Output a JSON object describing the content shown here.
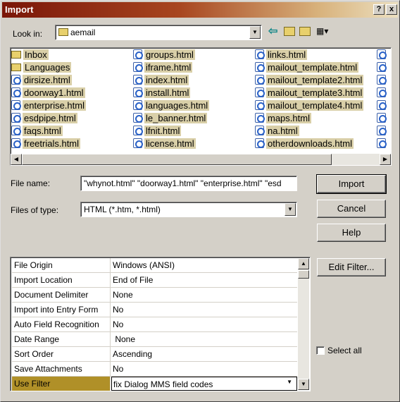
{
  "window": {
    "title": "Import"
  },
  "titlebar": {
    "help_btn": "?",
    "close_btn": "x"
  },
  "look_in": {
    "label": "Look in:",
    "value": "aemail"
  },
  "file_list": {
    "columns": [
      [
        {
          "name": "Inbox",
          "icon": "folder-icon"
        },
        {
          "name": "Languages",
          "icon": "folder-icon"
        },
        {
          "name": "dirsize.html",
          "icon": "html-file-icon"
        },
        {
          "name": "doorway1.html",
          "icon": "html-file-icon"
        },
        {
          "name": "enterprise.html",
          "icon": "html-file-icon"
        },
        {
          "name": "esdpipe.html",
          "icon": "html-file-icon"
        },
        {
          "name": "faqs.html",
          "icon": "html-file-icon"
        },
        {
          "name": "freetrials.html",
          "icon": "html-file-icon"
        }
      ],
      [
        {
          "name": "groups.html",
          "icon": "html-file-icon"
        },
        {
          "name": "iframe.html",
          "icon": "html-file-icon"
        },
        {
          "name": "index.html",
          "icon": "html-file-icon"
        },
        {
          "name": "install.html",
          "icon": "html-file-icon"
        },
        {
          "name": "languages.html",
          "icon": "html-file-icon"
        },
        {
          "name": "le_banner.html",
          "icon": "html-file-icon"
        },
        {
          "name": "lfnit.html",
          "icon": "html-file-icon"
        },
        {
          "name": "license.html",
          "icon": "html-file-icon"
        }
      ],
      [
        {
          "name": "links.html",
          "icon": "html-file-icon"
        },
        {
          "name": "mailout_template.html",
          "icon": "html-file-icon"
        },
        {
          "name": "mailout_template2.html",
          "icon": "html-file-icon"
        },
        {
          "name": "mailout_template3.html",
          "icon": "html-file-icon"
        },
        {
          "name": "mailout_template4.html",
          "icon": "html-file-icon"
        },
        {
          "name": "maps.html",
          "icon": "html-file-icon"
        },
        {
          "name": "na.html",
          "icon": "html-file-icon"
        },
        {
          "name": "otherdownloads.html",
          "icon": "html-file-icon"
        }
      ]
    ]
  },
  "file_name": {
    "label": "File name:",
    "value": "\"whynot.html\" \"doorway1.html\" \"enterprise.html\" \"esd"
  },
  "file_type": {
    "label": "Files of type:",
    "value": "HTML (*.htm, *.html)"
  },
  "buttons": {
    "import": "Import",
    "cancel": "Cancel",
    "help": "Help",
    "edit_filter": "Edit Filter..."
  },
  "options": [
    {
      "key": "File Origin",
      "value": "Windows (ANSI)"
    },
    {
      "key": "Import Location",
      "value": "End of File"
    },
    {
      "key": "Document Delimiter",
      "value": "None"
    },
    {
      "key": "Import into Entry Form",
      "value": "No"
    },
    {
      "key": "Auto Field Recognition",
      "value": "No"
    },
    {
      "key": "Date Range",
      "value": " None"
    },
    {
      "key": "Sort Order",
      "value": "Ascending"
    },
    {
      "key": "Save Attachments",
      "value": "No"
    },
    {
      "key": "Use Filter",
      "value": "fix Dialog MMS field codes"
    }
  ],
  "select_all": {
    "label": "Select all",
    "checked": false
  }
}
